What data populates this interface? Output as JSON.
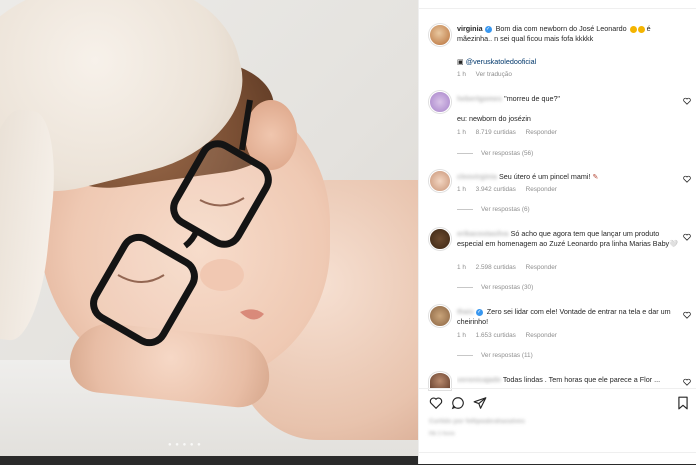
{
  "post": {
    "username": "virginia",
    "caption": "Bom dia com newborn do José Leonardo",
    "caption_cont": "é mãezinha.. n sei qual ficou mais fofa kkkkk",
    "photographer": "@veruskatoledooficial",
    "time": "1 h",
    "translate": "Ver tradução"
  },
  "comments": [
    {
      "user": "hebertgomes",
      "text": "\"morreu de que?\"",
      "text2": "eu: newborn do josézin",
      "time": "1 h",
      "likes": "8.719 curtidas",
      "reply": "Responder",
      "replies": "Ver respostas (56)"
    },
    {
      "user": "cleovirginia",
      "text": "Seu útero é um pincel mami!",
      "time": "1 h",
      "likes": "3.942 curtidas",
      "reply": "Responder",
      "replies": "Ver respostas (6)"
    },
    {
      "user": "erikacostasilva",
      "text": "Só acho que agora tem que lançar um produto especial em homenagem ao Zuzé Leonardo pra linha Marias Baby🤍",
      "time": "1 h",
      "likes": "2.598 curtidas",
      "reply": "Responder",
      "replies": "Ver respostas (30)"
    },
    {
      "user": "thais",
      "text": "Zero sei lidar com ele! Vontade de entrar na tela e dar um cheirinho!",
      "time": "1 h",
      "likes": "1.653 curtidas",
      "reply": "Responder",
      "replies": "Ver respostas (11)"
    },
    {
      "user": "veronicajade",
      "text": "Todas lindas . Tem horas que ele parece a Flor ...",
      "time": "",
      "likes": "",
      "reply": "",
      "replies": ""
    }
  ],
  "likes_line": "Curtido por fellipeabrahaoalves",
  "date_line": "Há 1 hora",
  "icons": {
    "like": "heart-icon",
    "comment": "comment-icon",
    "share": "share-icon",
    "save": "bookmark-icon"
  },
  "colors": {
    "link": "#00376b",
    "verified": "#3897f0",
    "muted": "#8e8e8e"
  }
}
